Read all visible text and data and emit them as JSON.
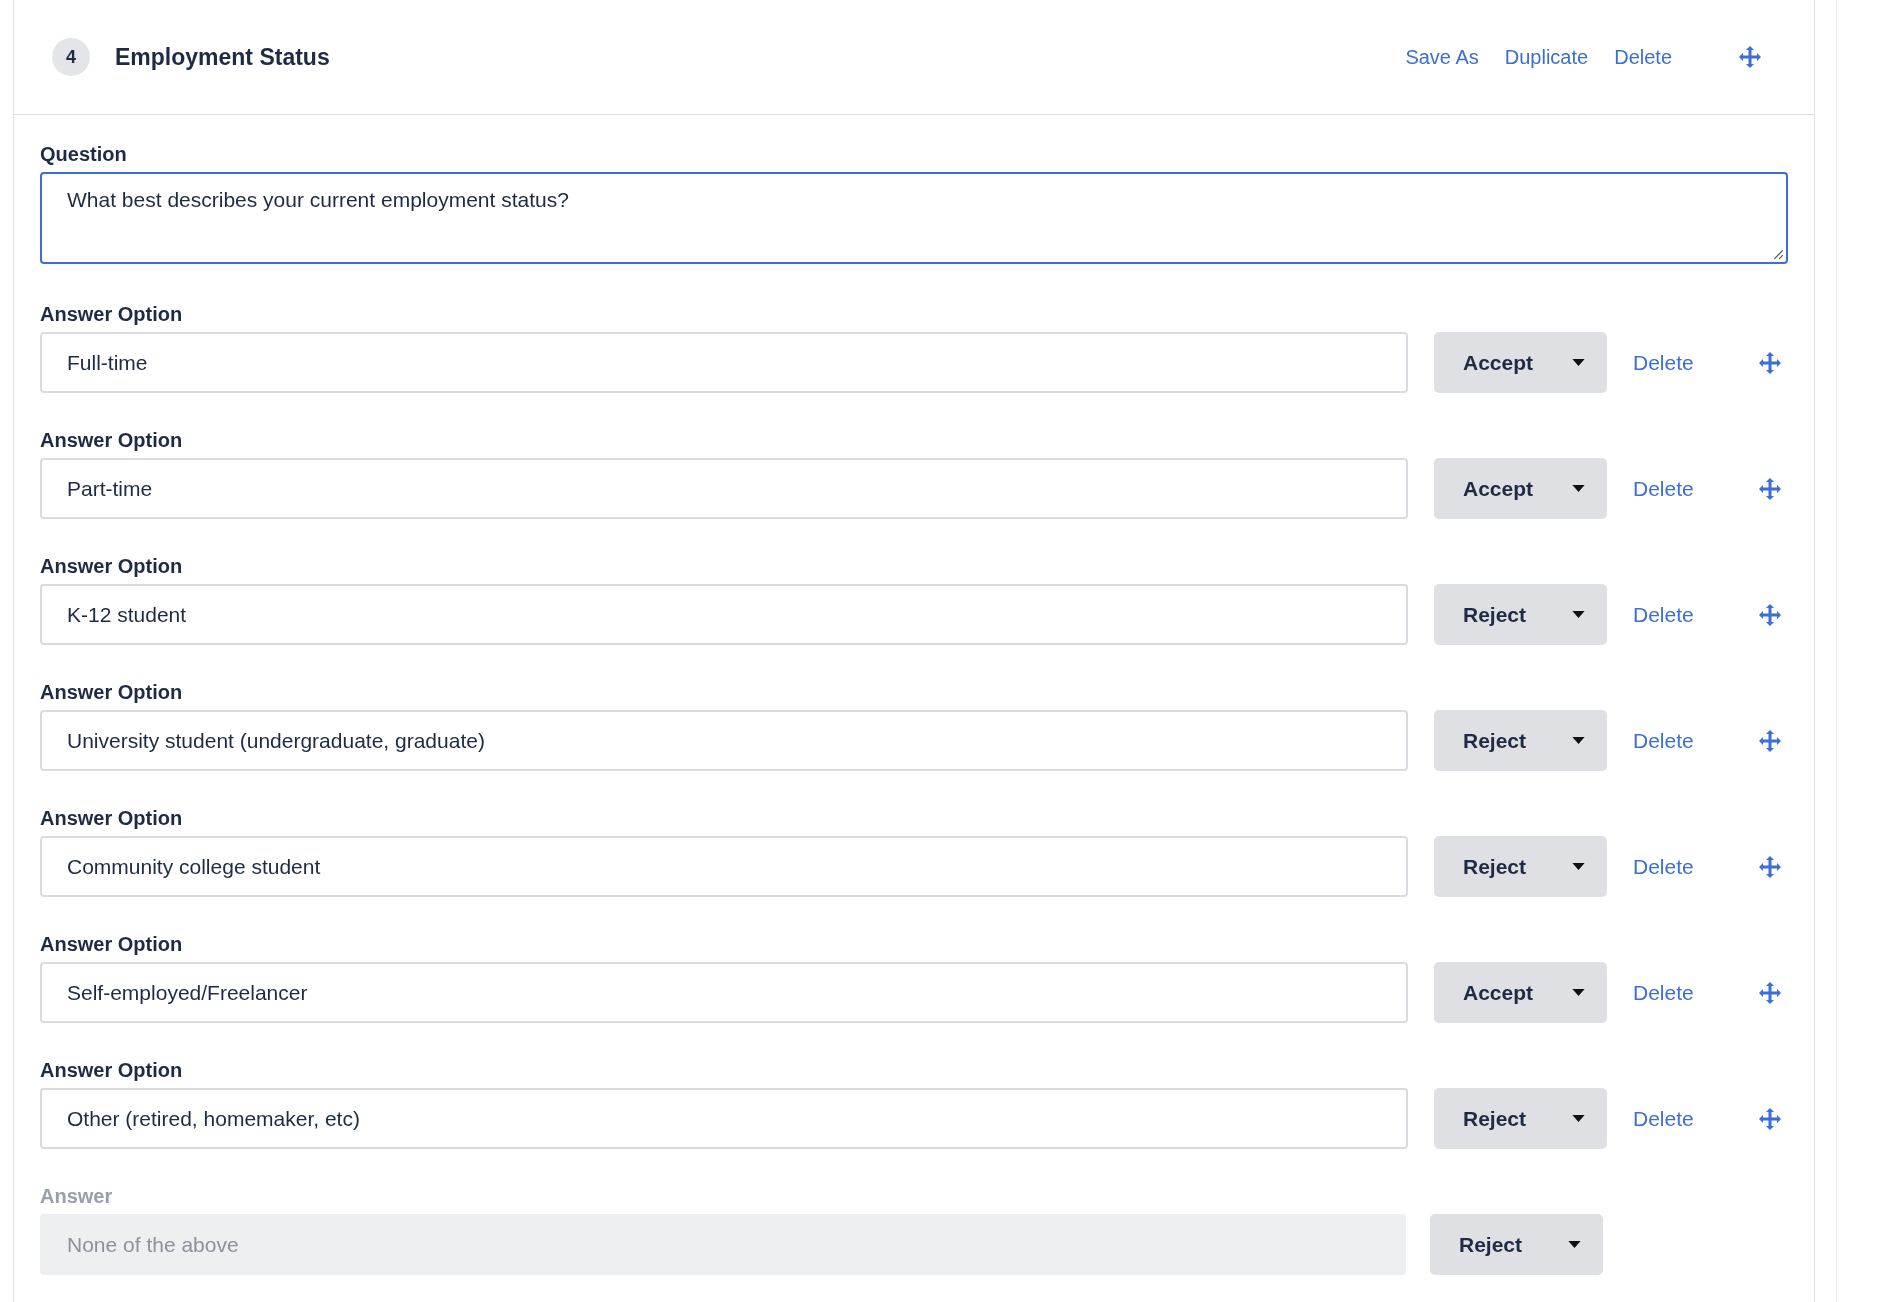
{
  "header": {
    "number": "4",
    "title": "Employment Status",
    "actions": [
      "Save As",
      "Duplicate",
      "Delete"
    ]
  },
  "question": {
    "label": "Question",
    "value": "What best describes your current employment status?"
  },
  "options": [
    {
      "label": "Answer Option",
      "value": "Full-time",
      "decision": "Accept",
      "disabled": false,
      "delete": "Delete"
    },
    {
      "label": "Answer Option",
      "value": "Part-time",
      "decision": "Accept",
      "disabled": false,
      "delete": "Delete"
    },
    {
      "label": "Answer Option",
      "value": "K-12 student",
      "decision": "Reject",
      "disabled": false,
      "delete": "Delete"
    },
    {
      "label": "Answer Option",
      "value": "University student (undergraduate, graduate)",
      "decision": "Reject",
      "disabled": false,
      "delete": "Delete"
    },
    {
      "label": "Answer Option",
      "value": "Community college student",
      "decision": "Reject",
      "disabled": false,
      "delete": "Delete"
    },
    {
      "label": "Answer Option",
      "value": "Self-employed/Freelancer",
      "decision": "Accept",
      "disabled": false,
      "delete": "Delete"
    },
    {
      "label": "Answer Option",
      "value": "Other (retired, homemaker, etc)",
      "decision": "Reject",
      "disabled": false,
      "delete": "Delete"
    },
    {
      "label": "Answer",
      "value": "None of the above",
      "decision": "Reject",
      "disabled": true
    }
  ]
}
